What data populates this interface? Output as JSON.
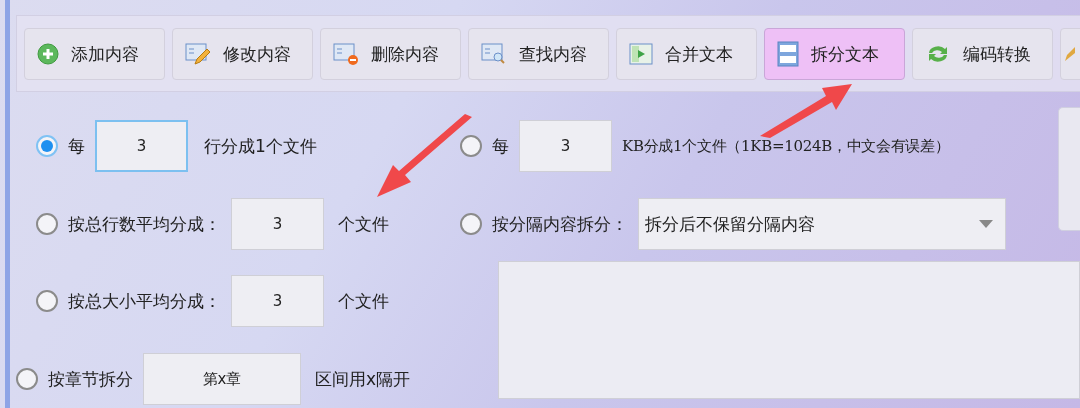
{
  "toolbar": [
    {
      "label": "添加内容",
      "kind": "add",
      "selected": false
    },
    {
      "label": "修改内容",
      "kind": "edit",
      "selected": false
    },
    {
      "label": "删除内容",
      "kind": "delete",
      "selected": false
    },
    {
      "label": "查找内容",
      "kind": "find",
      "selected": false
    },
    {
      "label": "合并文本",
      "kind": "merge",
      "selected": false
    },
    {
      "label": "拆分文本",
      "kind": "split",
      "selected": true
    },
    {
      "label": "编码转换",
      "kind": "convert",
      "selected": false
    }
  ],
  "options": [
    {
      "selected": true,
      "label": "每",
      "value": "3",
      "suffix": "行分成1个文件"
    },
    {
      "selected": false,
      "label": "每",
      "value": "3",
      "suffix": "KB分成1个文件（1KB=1024B，中文会有误差）"
    },
    {
      "selected": false,
      "label": "按总行数平均分成：",
      "value": "3",
      "suffix": "个文件"
    },
    {
      "selected": false,
      "label": "按分隔内容拆分：",
      "dropdown": "拆分后不保留分隔内容"
    },
    {
      "selected": false,
      "label": "按总大小平均分成：",
      "value": "3",
      "suffix": "个文件"
    },
    {
      "selected": false,
      "label": "按章节拆分",
      "value": "第x章",
      "suffix": "区间用x隔开"
    }
  ]
}
